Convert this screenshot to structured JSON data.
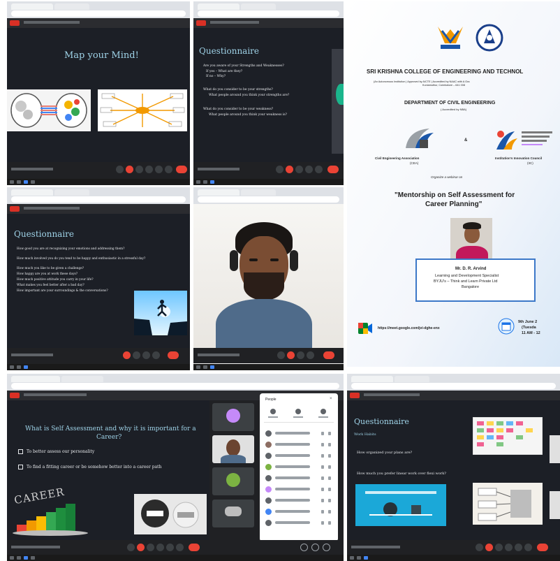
{
  "panel_tl": {
    "slide_title": "Map your Mind!"
  },
  "panel_tm": {
    "slide_title": "Questionnaire",
    "bullet_1": "Are you aware of your Strengths and Weaknesses?",
    "sub_1": "If yes – What are they?",
    "sub_2": "If no – Why?",
    "bullet_2": "What do you consider to be your strengths?",
    "sub_3": "What people around you think your strengths are?",
    "bullet_3": "What do you consider to be your weakness?",
    "sub_4": "What people around you think your weakness is?"
  },
  "panel_ml": {
    "slide_title": "Questionnaire",
    "bullets": [
      "How good you are at recognizing your emotions and addressing them?",
      "How much involved you do you tend to be happy and enthusiastic in a stressful day?",
      "How much you like to be given a challenge?",
      "How happy are you at work these days?",
      "How much positive attitude you carry in your life?",
      "What makes you feel better after a bad day?",
      "How important are your surroundings & the conversations?"
    ]
  },
  "panel_bl": {
    "slide_title_1": "What is Self Assessment and why it is important for a",
    "slide_title_2": "Career?",
    "check_1": "To better assess our personality",
    "check_2": "To find a fitting career or be somehow better into a career path",
    "career_art": "CAREER",
    "ppl_title": "People"
  },
  "panel_br": {
    "slide_title": "Questionnaire",
    "section": "Work Habits",
    "bullet_1": "How organized your plans are?",
    "bullet_2": "How much you prefer linear work over flexi work?"
  },
  "poster": {
    "college": "SRI KRISHNA COLLEGE OF ENGINEERING AND TECHNOL",
    "affil_1": "(An Autonomous Institution | Approved by AICTE | Accredited by NAAC with A Gra",
    "affil_2": "Kuniamuthur, Coimbatore – 641 008",
    "dept": "DEPARTMENT OF CIVIL ENGINEERING",
    "nba": "( Accredited by NBA)",
    "cea": "Civil Engineering Association",
    "cea_abbr": "(CEA)",
    "amp": "&",
    "iic": "Institution's Innovation Council",
    "iic_abbr": "(IIC)",
    "organize": "Organize a webinar on",
    "topic_1": "\"Mentorship on Self Assessment for",
    "topic_2": "Career Planning\"",
    "speaker_name": "Mr. D. R. Arvind",
    "speaker_role": "Learning and Development Specialist",
    "speaker_org": "BYJU's – Think and Learn Private Ltd",
    "speaker_city": "Bangalore",
    "link": "https://meet.google.com/jvi-dghe-enx",
    "date": "9th June 2",
    "day": "(Tuesda",
    "time": "11 AM - 12"
  },
  "colors": {
    "meet_bg": "#202124",
    "slide_bg": "#1c1f26",
    "slide_title": "#9fd3e8",
    "end_call": "#ea4335",
    "poster_box": "#3c78c8"
  }
}
